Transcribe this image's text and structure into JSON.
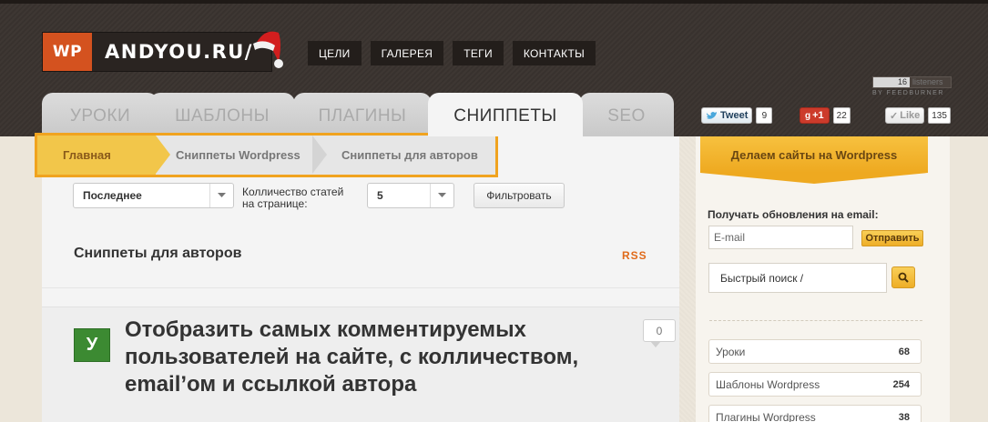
{
  "logo": {
    "wp": "WP",
    "site": "ANDYOU.RU/"
  },
  "topnav": [
    "ЦЕЛИ",
    "ГАЛЕРЕЯ",
    "ТЕГИ",
    "КОНТАКТЫ"
  ],
  "feedburner": {
    "count": "16",
    "unit": "listeners",
    "by": "BY FEEDBURNER"
  },
  "tabs": [
    "УРОКИ",
    "ШАБЛОНЫ",
    "ПЛАГИНЫ",
    "СНИППЕТЫ",
    "SEO"
  ],
  "active_tab": "СНИППЕТЫ",
  "social": {
    "tweet_label": "Tweet",
    "tweet_count": "9",
    "gplus_label": "+1",
    "gplus_count": "22",
    "like_label": "Like",
    "like_count": "135"
  },
  "breadcrumb": [
    "Главная",
    "Сниппеты Wordpress",
    "Сниппеты для авторов"
  ],
  "filters": {
    "sort_value": "Последнее",
    "per_page_label_1": "Колличество статей",
    "per_page_label_2": "на странице:",
    "per_page_value": "5",
    "filter_button": "Фильтровать"
  },
  "section_title": "Сниппеты для авторов",
  "rss_label": "RSS",
  "post": {
    "badge": "У",
    "title_lines": [
      "Отобразить самых комментируемых",
      "пользователей на сайте, с колличеством,",
      "email’ом и ссылкой автора"
    ],
    "comments": "0"
  },
  "sidebar": {
    "promo": "Делаем сайты на Wordpress",
    "email_label": "Получать обновления на email:",
    "email_placeholder": "E-mail",
    "send_button": "Отправить",
    "search_placeholder": "Быстрый поиск /",
    "categories": [
      {
        "name": "Уроки",
        "count": "68"
      },
      {
        "name": "Шаблоны Wordpress",
        "count": "254"
      },
      {
        "name": "Плагины Wordpress",
        "count": "38"
      }
    ]
  },
  "colors": {
    "accent": "#f0a31f",
    "brand": "#d4521f",
    "header_bg": "#3a332f",
    "badge_green": "#3c8a32",
    "rss": "#e06a1a"
  }
}
